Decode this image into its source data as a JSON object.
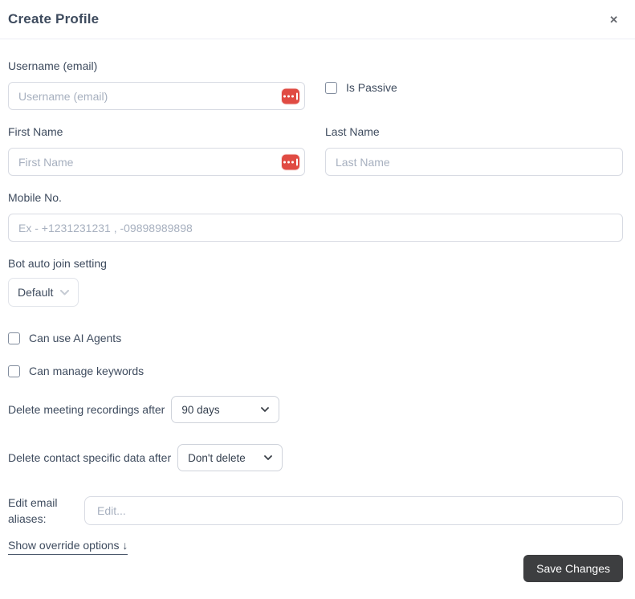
{
  "header": {
    "title": "Create Profile",
    "close_glyph": "✕"
  },
  "form": {
    "username": {
      "label": "Username (email)",
      "placeholder": "Username (email)",
      "value": ""
    },
    "is_passive": {
      "label": "Is Passive",
      "checked": false
    },
    "first_name": {
      "label": "First Name",
      "placeholder": "First Name",
      "value": ""
    },
    "last_name": {
      "label": "Last Name",
      "placeholder": "Last Name",
      "value": ""
    },
    "mobile": {
      "label": "Mobile No.",
      "placeholder": "Ex - +1231231231 , -09898989898",
      "value": ""
    },
    "bot_auto_join": {
      "label": "Bot auto join setting",
      "value": "Default"
    },
    "can_use_ai_agents": {
      "label": "Can use AI Agents",
      "checked": false
    },
    "can_manage_keywords": {
      "label": "Can manage keywords",
      "checked": false
    },
    "delete_recordings": {
      "label": "Delete meeting recordings after",
      "value": "90 days"
    },
    "delete_contact_data": {
      "label": "Delete contact specific data after",
      "value": "Don't delete"
    },
    "email_aliases": {
      "label": "Edit email aliases:",
      "placeholder": "Edit...",
      "value": ""
    },
    "show_override_label": "Show override options ↓"
  },
  "footer": {
    "save_label": "Save Changes"
  },
  "icons": {
    "close": "x-glyph",
    "chevron_down": "v-glyph",
    "password_autofill": "red rounded square with three dots and caret bar",
    "arrow_down": "↓"
  },
  "colors": {
    "accent_red": "#e04b43",
    "save_button_bg": "#3d3e40",
    "label_text": "#3e4b5e",
    "input_border": "#d8dbe3",
    "placeholder_text": "#a7b0bf",
    "header_divider": "#ecedf4"
  }
}
